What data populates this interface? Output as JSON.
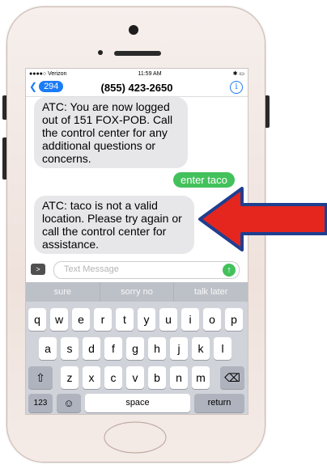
{
  "status": {
    "carrier": "●●●●○ Verizon",
    "time": "11:59 AM",
    "battery": "✱ ▭"
  },
  "nav": {
    "back_count": "294",
    "title": "(855) 423-2650",
    "info": "i"
  },
  "messages": {
    "m1": "ATC: You are now logged out of 151  FOX-POB. Call the control center for any additional questions or concerns.",
    "m2": "enter taco",
    "m3": "ATC: taco is not a valid location. Please try again or call the control center for assistance."
  },
  "input": {
    "placeholder": "Text Message",
    "send": "↑",
    "camera": ">"
  },
  "suggestions": [
    "sure",
    "sorry no",
    "talk later"
  ],
  "keyboard": {
    "row1": [
      "q",
      "w",
      "e",
      "r",
      "t",
      "y",
      "u",
      "i",
      "o",
      "p"
    ],
    "row2": [
      "a",
      "s",
      "d",
      "f",
      "g",
      "h",
      "j",
      "k",
      "l"
    ],
    "row3": [
      "z",
      "x",
      "c",
      "v",
      "b",
      "n",
      "m"
    ],
    "shift": "⇧",
    "delete": "⌫",
    "num": "123",
    "emoji": "☺",
    "space": "space",
    "return": "return"
  },
  "colors": {
    "ios_blue": "#1b7cf5",
    "imessage_green": "#43c15b",
    "arrow_red": "#e4261e",
    "arrow_outline": "#1f3f8f"
  }
}
